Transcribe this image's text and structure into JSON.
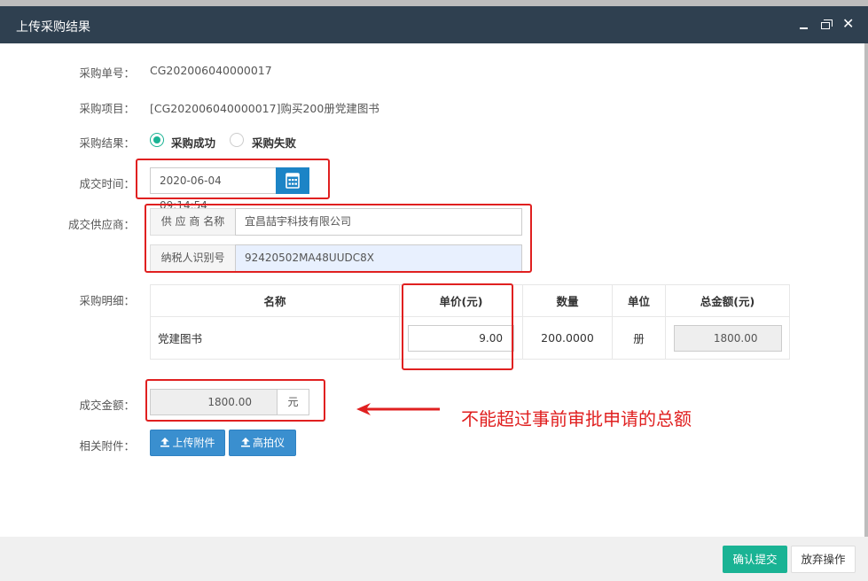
{
  "window": {
    "title": "上传采购结果"
  },
  "form": {
    "order_no_label": "采购单号：",
    "order_no": "CG202006040000017",
    "project_label": "采购项目：",
    "project": "[CG202006040000017]购买200册党建图书",
    "result_label": "采购结果：",
    "result_options": [
      "采购成功",
      "采购失败"
    ],
    "result_selected": "采购成功",
    "deal_time_label": "成交时间：",
    "deal_time": "2020-06-04 09:14:54",
    "supplier_label": "成交供应商：",
    "supplier_name_label": "供 应 商 名称",
    "supplier_name": "宜昌喆宇科技有限公司",
    "tax_id_label": "纳税人识别号",
    "tax_id": "92420502MA48UUDC8X",
    "detail_label": "采购明细：",
    "amount_label": "成交金额：",
    "amount": "1800.00",
    "amount_unit": "元",
    "attachments_label": "相关附件："
  },
  "detail_table": {
    "headers": [
      "名称",
      "单价(元)",
      "数量",
      "单位",
      "总金额(元)"
    ],
    "rows": [
      {
        "name": "党建图书",
        "unit_price": "9.00",
        "quantity": "200.0000",
        "unit": "册",
        "total": "1800.00"
      }
    ]
  },
  "buttons": {
    "upload": "上传附件",
    "scanner": "高拍仪",
    "confirm": "确认提交",
    "cancel": "放弃操作"
  },
  "annotation": {
    "text": "不能超过事前审批申请的总额"
  },
  "colors": {
    "titlebar": "#2f4050",
    "accent_green": "#1ab394",
    "button_blue": "#3a8fcf",
    "annotation_red": "#e02020"
  }
}
